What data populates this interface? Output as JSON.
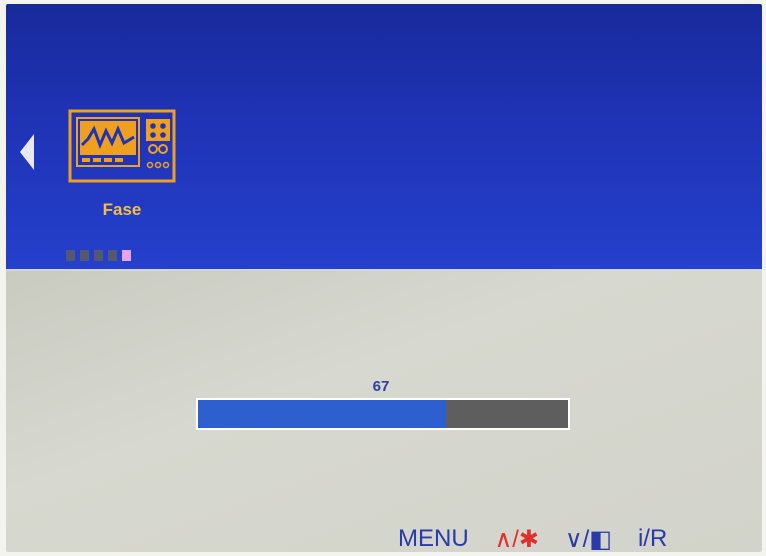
{
  "osd": {
    "menu_item": {
      "label": "Fase",
      "icon": "oscilloscope-icon"
    },
    "pager": {
      "total": 5,
      "active_index": 4
    },
    "slider": {
      "value": "67",
      "fraction": 0.67
    },
    "hints": {
      "menu": "MENU",
      "up": "∧/✱",
      "down": "∨/◧",
      "info": "i/R"
    },
    "colors": {
      "top_panel": "#1f33b6",
      "bottom_panel": "#d2d3ca",
      "accent_orange": "#f0c040",
      "fill": "#2d5fcf",
      "track": "#5e5e5e",
      "active_dot": "#e8a4e8"
    }
  }
}
